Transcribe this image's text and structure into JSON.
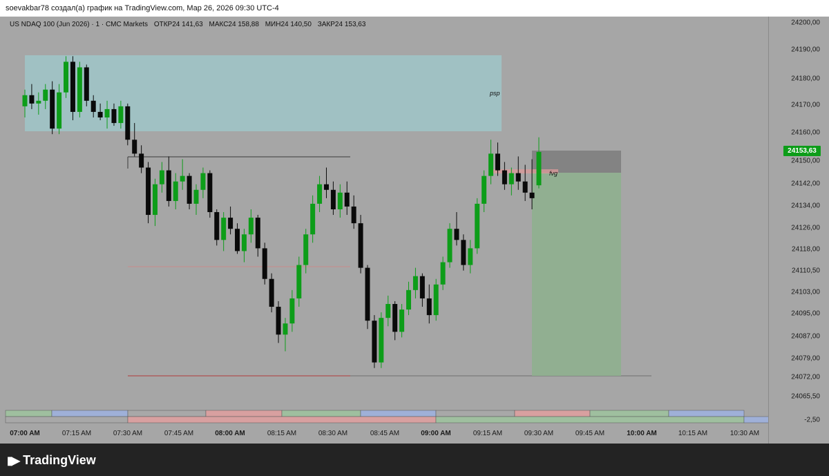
{
  "header": {
    "attribution": "soevakbar78 создал(а) график на TradingView.com, Мар 26, 2026 09:30 UTC-4"
  },
  "symbol": {
    "name": "US NDAQ 100 (Jun 2026) · 1 · CMC Markets",
    "open": "ОТКР24 141,63",
    "high": "МАКС24 158,88",
    "low": "МИН24 140,50",
    "close": "ЗАКР24 153,63"
  },
  "price_axis": {
    "labels": [
      "24200,00",
      "24190,00",
      "24180,00",
      "24170,00",
      "24160,00",
      "24150,00",
      "24142,00",
      "24134,00",
      "24126,00",
      "24118,00",
      "24110,50",
      "24103,00",
      "24095,00",
      "24087,00",
      "24079,00",
      "24072,00",
      "24065,50"
    ],
    "current_price": "24153,63",
    "indicator_value": "-2,50"
  },
  "time_axis": {
    "labels": [
      {
        "text": "07:00 AM",
        "bold": true
      },
      {
        "text": "07:15 AM",
        "bold": false
      },
      {
        "text": "07:30 AM",
        "bold": false
      },
      {
        "text": "07:45 AM",
        "bold": false
      },
      {
        "text": "08:00 AM",
        "bold": true
      },
      {
        "text": "08:15 AM",
        "bold": false
      },
      {
        "text": "08:30 AM",
        "bold": false
      },
      {
        "text": "08:45 AM",
        "bold": false
      },
      {
        "text": "09:00 AM",
        "bold": true
      },
      {
        "text": "09:15 AM",
        "bold": false
      },
      {
        "text": "09:30 AM",
        "bold": false
      },
      {
        "text": "09:45 AM",
        "bold": false
      },
      {
        "text": "10:00 AM",
        "bold": true
      },
      {
        "text": "10:15 AM",
        "bold": false
      },
      {
        "text": "10:30 AM",
        "bold": false
      }
    ]
  },
  "annotations": {
    "psp": "psp",
    "fvg": "fvg"
  },
  "colors": {
    "up": "#0d9d19",
    "down": "#0a0a0a",
    "psp_zone": "#9fc5c8",
    "target_zone": "#8fb08f",
    "stop_zone": "#7a7a7a",
    "fvg": "#d99a9a",
    "chart_bg": "#a6a6a6"
  },
  "branding": {
    "name": "TradingView"
  },
  "chart_data": {
    "type": "candlestick",
    "interval": "1",
    "symbol": "US NDAQ 100 (Jun 2026)",
    "series": [
      {
        "t": "07:00",
        "o": 24170,
        "h": 24176,
        "l": 24166,
        "c": 24174
      },
      {
        "t": "07:02",
        "o": 24174,
        "h": 24178,
        "l": 24169,
        "c": 24171
      },
      {
        "t": "07:04",
        "o": 24171,
        "h": 24175,
        "l": 24167,
        "c": 24172
      },
      {
        "t": "07:06",
        "o": 24172,
        "h": 24178,
        "l": 24169,
        "c": 24176
      },
      {
        "t": "07:08",
        "o": 24176,
        "h": 24179,
        "l": 24160,
        "c": 24162
      },
      {
        "t": "07:10",
        "o": 24162,
        "h": 24178,
        "l": 24160,
        "c": 24175
      },
      {
        "t": "07:12",
        "o": 24175,
        "h": 24188,
        "l": 24173,
        "c": 24186
      },
      {
        "t": "07:14",
        "o": 24186,
        "h": 24188,
        "l": 24165,
        "c": 24168
      },
      {
        "t": "07:16",
        "o": 24168,
        "h": 24186,
        "l": 24166,
        "c": 24184
      },
      {
        "t": "07:18",
        "o": 24184,
        "h": 24185,
        "l": 24170,
        "c": 24172
      },
      {
        "t": "07:20",
        "o": 24172,
        "h": 24174,
        "l": 24166,
        "c": 24168
      },
      {
        "t": "07:22",
        "o": 24168,
        "h": 24171,
        "l": 24165,
        "c": 24166
      },
      {
        "t": "07:24",
        "o": 24166,
        "h": 24172,
        "l": 24162,
        "c": 24169
      },
      {
        "t": "07:26",
        "o": 24169,
        "h": 24171,
        "l": 24163,
        "c": 24164
      },
      {
        "t": "07:28",
        "o": 24164,
        "h": 24172,
        "l": 24162,
        "c": 24170
      },
      {
        "t": "07:30",
        "o": 24170,
        "h": 24171,
        "l": 24156,
        "c": 24158
      },
      {
        "t": "07:32",
        "o": 24158,
        "h": 24164,
        "l": 24152,
        "c": 24153
      },
      {
        "t": "07:34",
        "o": 24153,
        "h": 24156,
        "l": 24146,
        "c": 24148
      },
      {
        "t": "07:36",
        "o": 24148,
        "h": 24150,
        "l": 24128,
        "c": 24131
      },
      {
        "t": "07:38",
        "o": 24131,
        "h": 24144,
        "l": 24127,
        "c": 24142
      },
      {
        "t": "07:40",
        "o": 24142,
        "h": 24150,
        "l": 24139,
        "c": 24147
      },
      {
        "t": "07:42",
        "o": 24147,
        "h": 24152,
        "l": 24134,
        "c": 24136
      },
      {
        "t": "07:44",
        "o": 24136,
        "h": 24146,
        "l": 24133,
        "c": 24143
      },
      {
        "t": "07:46",
        "o": 24143,
        "h": 24151,
        "l": 24140,
        "c": 24145
      },
      {
        "t": "07:48",
        "o": 24145,
        "h": 24146,
        "l": 24133,
        "c": 24135
      },
      {
        "t": "07:50",
        "o": 24135,
        "h": 24142,
        "l": 24131,
        "c": 24140
      },
      {
        "t": "07:52",
        "o": 24140,
        "h": 24148,
        "l": 24137,
        "c": 24146
      },
      {
        "t": "07:54",
        "o": 24146,
        "h": 24147,
        "l": 24130,
        "c": 24132
      },
      {
        "t": "07:56",
        "o": 24132,
        "h": 24133,
        "l": 24120,
        "c": 24122
      },
      {
        "t": "07:58",
        "o": 24122,
        "h": 24132,
        "l": 24118,
        "c": 24130
      },
      {
        "t": "08:00",
        "o": 24130,
        "h": 24134,
        "l": 24124,
        "c": 24126
      },
      {
        "t": "08:02",
        "o": 24126,
        "h": 24128,
        "l": 24117,
        "c": 24118
      },
      {
        "t": "08:04",
        "o": 24118,
        "h": 24126,
        "l": 24114,
        "c": 24124
      },
      {
        "t": "08:06",
        "o": 24124,
        "h": 24133,
        "l": 24121,
        "c": 24130
      },
      {
        "t": "08:08",
        "o": 24130,
        "h": 24131,
        "l": 24116,
        "c": 24119
      },
      {
        "t": "08:10",
        "o": 24119,
        "h": 24121,
        "l": 24106,
        "c": 24108
      },
      {
        "t": "08:12",
        "o": 24108,
        "h": 24110,
        "l": 24096,
        "c": 24098
      },
      {
        "t": "08:14",
        "o": 24098,
        "h": 24100,
        "l": 24085,
        "c": 24088
      },
      {
        "t": "08:16",
        "o": 24088,
        "h": 24094,
        "l": 24082,
        "c": 24092
      },
      {
        "t": "08:18",
        "o": 24092,
        "h": 24104,
        "l": 24089,
        "c": 24101
      },
      {
        "t": "08:20",
        "o": 24101,
        "h": 24116,
        "l": 24098,
        "c": 24113
      },
      {
        "t": "08:22",
        "o": 24113,
        "h": 24126,
        "l": 24110,
        "c": 24124
      },
      {
        "t": "08:24",
        "o": 24124,
        "h": 24138,
        "l": 24121,
        "c": 24135
      },
      {
        "t": "08:26",
        "o": 24135,
        "h": 24145,
        "l": 24132,
        "c": 24142
      },
      {
        "t": "08:28",
        "o": 24142,
        "h": 24148,
        "l": 24137,
        "c": 24140
      },
      {
        "t": "08:30",
        "o": 24140,
        "h": 24143,
        "l": 24131,
        "c": 24133
      },
      {
        "t": "08:32",
        "o": 24133,
        "h": 24142,
        "l": 24130,
        "c": 24139
      },
      {
        "t": "08:34",
        "o": 24139,
        "h": 24143,
        "l": 24131,
        "c": 24134
      },
      {
        "t": "08:36",
        "o": 24134,
        "h": 24138,
        "l": 24126,
        "c": 24128
      },
      {
        "t": "08:38",
        "o": 24128,
        "h": 24131,
        "l": 24110,
        "c": 24112
      },
      {
        "t": "08:40",
        "o": 24112,
        "h": 24113,
        "l": 24090,
        "c": 24093
      },
      {
        "t": "08:42",
        "o": 24093,
        "h": 24095,
        "l": 24076,
        "c": 24078
      },
      {
        "t": "08:44",
        "o": 24078,
        "h": 24096,
        "l": 24076,
        "c": 24094
      },
      {
        "t": "08:46",
        "o": 24094,
        "h": 24102,
        "l": 24091,
        "c": 24099
      },
      {
        "t": "08:48",
        "o": 24099,
        "h": 24100,
        "l": 24086,
        "c": 24089
      },
      {
        "t": "08:50",
        "o": 24089,
        "h": 24099,
        "l": 24087,
        "c": 24097
      },
      {
        "t": "08:52",
        "o": 24097,
        "h": 24107,
        "l": 24095,
        "c": 24104
      },
      {
        "t": "08:54",
        "o": 24104,
        "h": 24112,
        "l": 24101,
        "c": 24109
      },
      {
        "t": "08:56",
        "o": 24109,
        "h": 24110,
        "l": 24098,
        "c": 24101
      },
      {
        "t": "08:58",
        "o": 24101,
        "h": 24106,
        "l": 24092,
        "c": 24095
      },
      {
        "t": "09:00",
        "o": 24095,
        "h": 24108,
        "l": 24093,
        "c": 24106
      },
      {
        "t": "09:02",
        "o": 24106,
        "h": 24116,
        "l": 24104,
        "c": 24114
      },
      {
        "t": "09:04",
        "o": 24114,
        "h": 24128,
        "l": 24112,
        "c": 24126
      },
      {
        "t": "09:06",
        "o": 24126,
        "h": 24132,
        "l": 24120,
        "c": 24122
      },
      {
        "t": "09:08",
        "o": 24122,
        "h": 24124,
        "l": 24111,
        "c": 24113
      },
      {
        "t": "09:10",
        "o": 24113,
        "h": 24122,
        "l": 24110,
        "c": 24119
      },
      {
        "t": "09:12",
        "o": 24119,
        "h": 24137,
        "l": 24117,
        "c": 24135
      },
      {
        "t": "09:14",
        "o": 24135,
        "h": 24147,
        "l": 24132,
        "c": 24145
      },
      {
        "t": "09:16",
        "o": 24145,
        "h": 24158,
        "l": 24142,
        "c": 24153
      },
      {
        "t": "09:18",
        "o": 24153,
        "h": 24157,
        "l": 24145,
        "c": 24147
      },
      {
        "t": "09:20",
        "o": 24147,
        "h": 24150,
        "l": 24140,
        "c": 24142
      },
      {
        "t": "09:22",
        "o": 24142,
        "h": 24148,
        "l": 24138,
        "c": 24146
      },
      {
        "t": "09:24",
        "o": 24146,
        "h": 24152,
        "l": 24140,
        "c": 24143
      },
      {
        "t": "09:26",
        "o": 24143,
        "h": 24149,
        "l": 24136,
        "c": 24139
      },
      {
        "t": "09:28",
        "o": 24139,
        "h": 24151,
        "l": 24133,
        "c": 24137
      },
      {
        "t": "09:30",
        "o": 24141.63,
        "h": 24158.88,
        "l": 24140.5,
        "c": 24153.63
      }
    ]
  }
}
